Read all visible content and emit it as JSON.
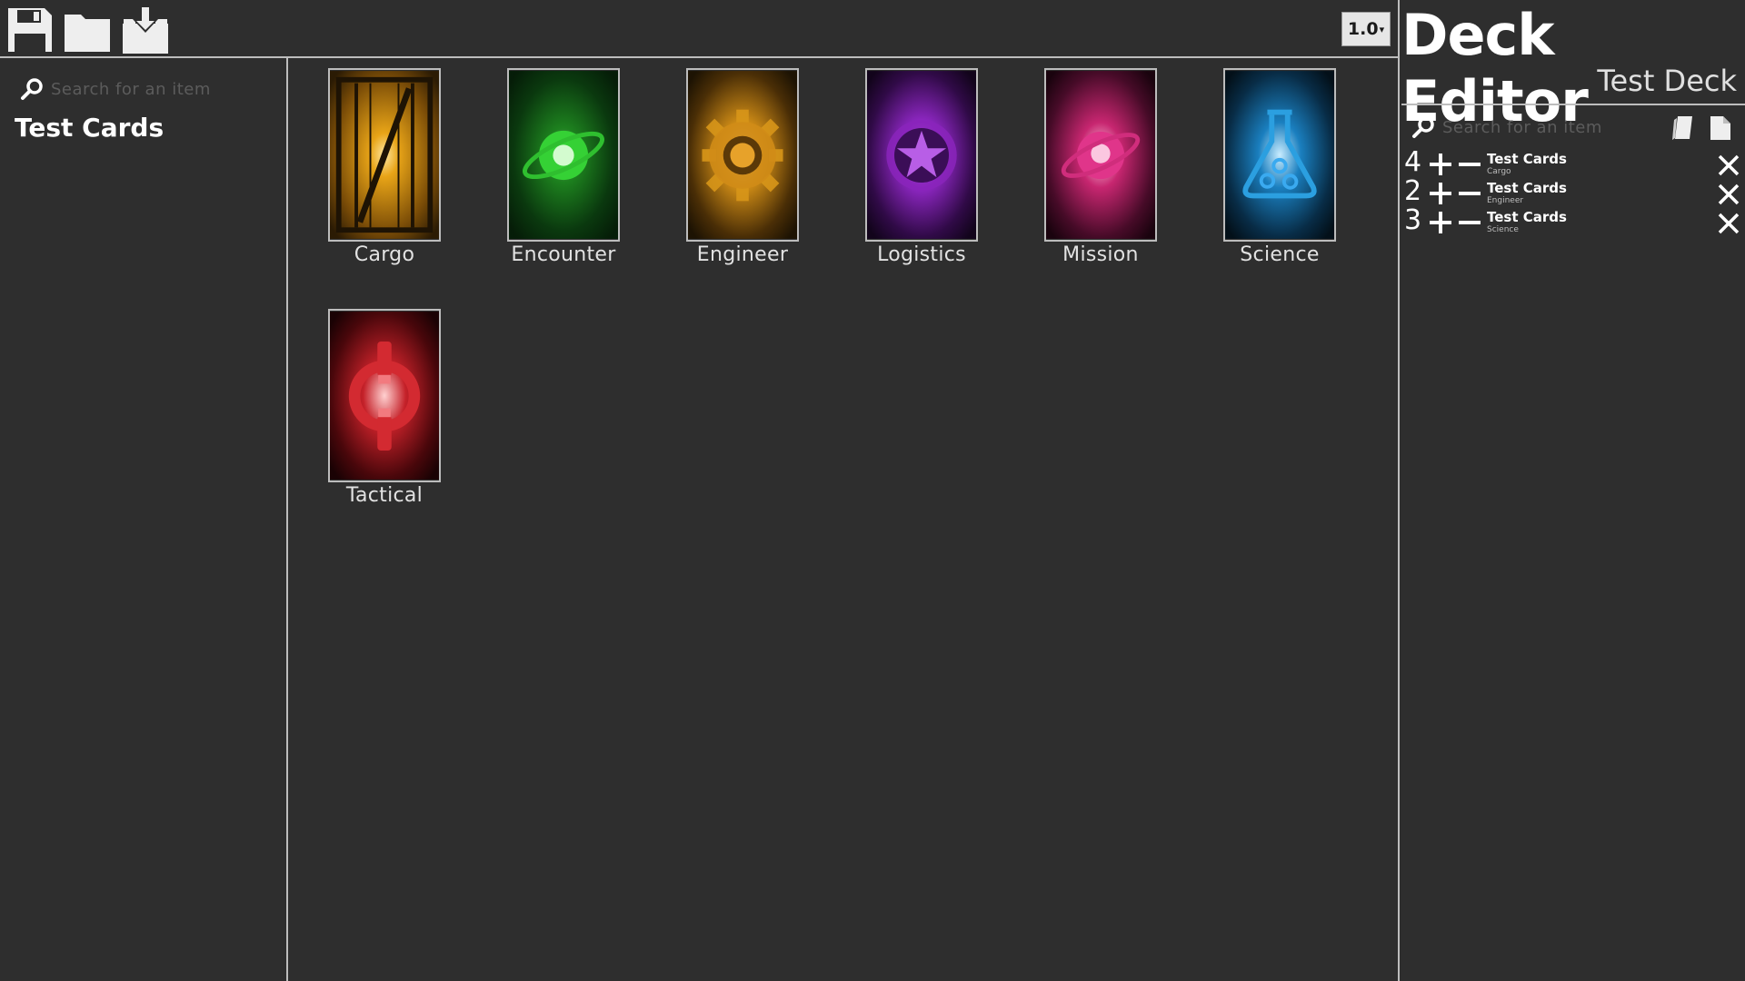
{
  "toolbar": {
    "icons": [
      "save-icon",
      "open-folder-icon",
      "download-icon"
    ],
    "version": "1.0"
  },
  "sidebar": {
    "search_placeholder": "Search for an item",
    "categories": [
      "Test Cards"
    ]
  },
  "cards": [
    {
      "label": "Cargo",
      "color": "#d89a12"
    },
    {
      "label": "Encounter",
      "color": "#27c62f"
    },
    {
      "label": "Engineer",
      "color": "#d3921a"
    },
    {
      "label": "Logistics",
      "color": "#9326c4"
    },
    {
      "label": "Mission",
      "color": "#d22a78"
    },
    {
      "label": "Science",
      "color": "#1f8fcf"
    },
    {
      "label": "Tactical",
      "color": "#c72127"
    }
  ],
  "deck": {
    "title": "Deck Editor",
    "name": "Test Deck",
    "search_placeholder": "Search for an item",
    "entries": [
      {
        "count": "4",
        "name": "Test Cards",
        "sub": "Cargo"
      },
      {
        "count": "2",
        "name": "Test Cards",
        "sub": "Engineer"
      },
      {
        "count": "3",
        "name": "Test Cards",
        "sub": "Science"
      }
    ]
  }
}
